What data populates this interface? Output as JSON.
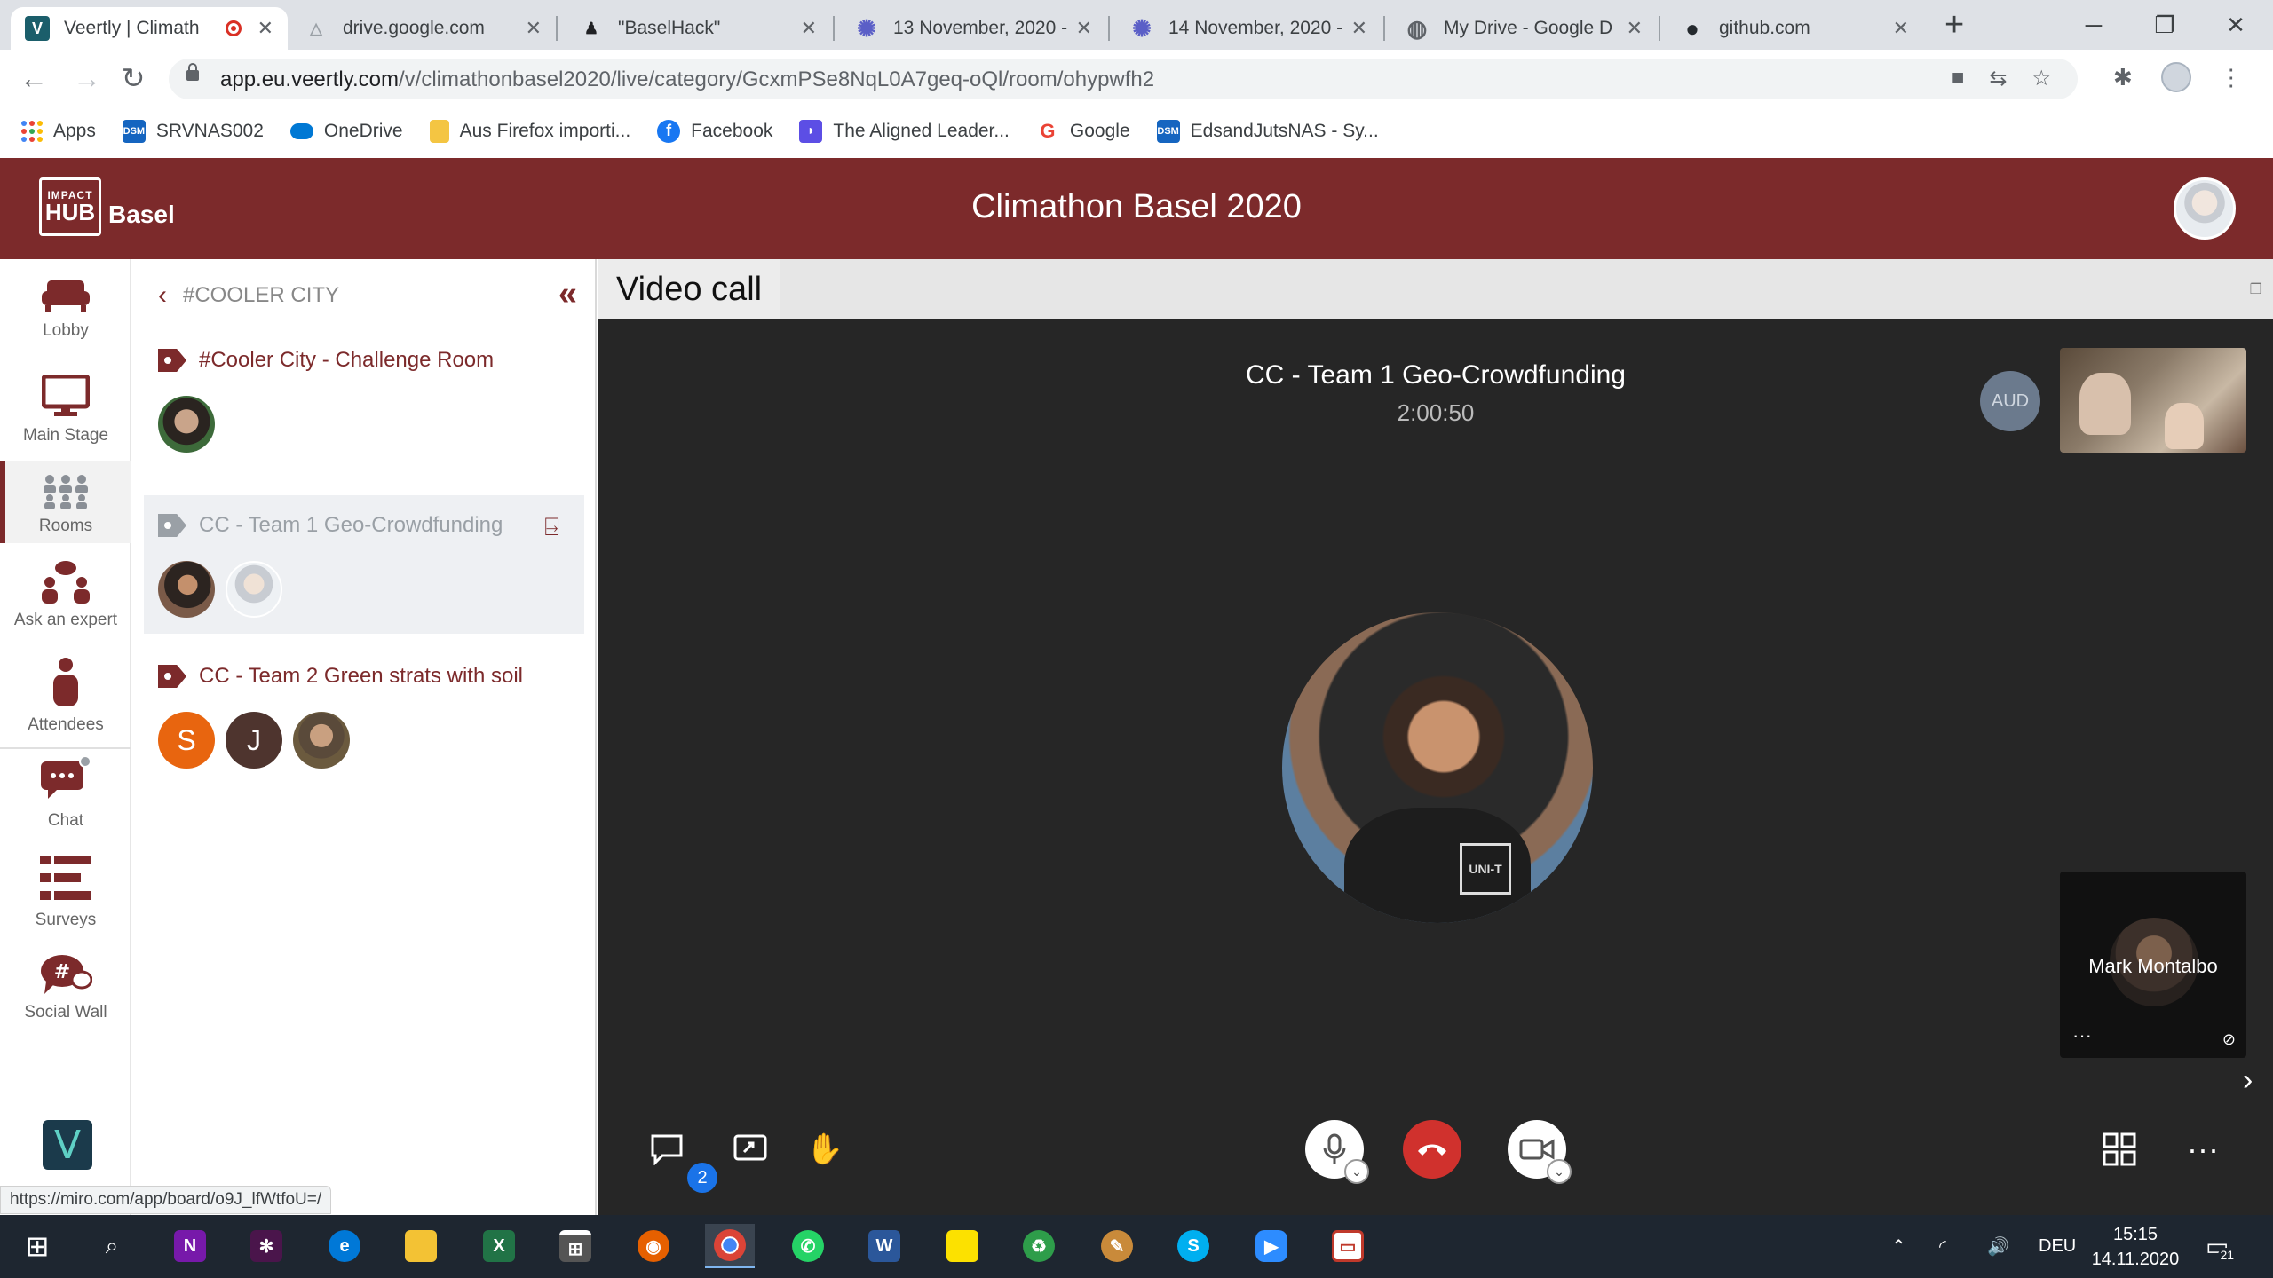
{
  "browser": {
    "tabs": [
      {
        "title": "Veertly | Climath",
        "favicon_color": "#1b5e6b",
        "glyph": "V"
      },
      {
        "title": "drive.google.com",
        "favicon_color": "#9aa0a6",
        "glyph": "△"
      },
      {
        "title": "\"BaselHack\"",
        "favicon_color": "#202124",
        "glyph": "♟"
      },
      {
        "title": "13 November, 2020 -",
        "favicon_color": "#5b5fc7",
        "glyph": "✺"
      },
      {
        "title": "14 November, 2020 -",
        "favicon_color": "#5b5fc7",
        "glyph": "✺"
      },
      {
        "title": "My Drive - Google D",
        "favicon_color": "#5f6368",
        "glyph": "◍"
      },
      {
        "title": "github.com",
        "favicon_color": "#24292e",
        "glyph": "●"
      }
    ],
    "new_tab_glyph": "+",
    "url_host": "app.eu.veertly.com",
    "url_path": "/v/climathonbasel2020/live/category/GcxmPSe8NqL0A7geq-oQl/room/ohypwfh2",
    "bookmarks": [
      {
        "label": "Apps",
        "icon": "apps-icon"
      },
      {
        "label": "SRVNAS002",
        "icon": "dsm-icon",
        "color": "#1565c0"
      },
      {
        "label": "OneDrive",
        "icon": "cloud-icon",
        "color": "#0078d4"
      },
      {
        "label": "Aus Firefox importi...",
        "icon": "folder-icon",
        "color": "#f4c542"
      },
      {
        "label": "Facebook",
        "icon": "facebook-icon",
        "color": "#1877f2"
      },
      {
        "label": "The Aligned Leader...",
        "icon": "aligned-icon",
        "color": "#5c4ee5"
      },
      {
        "label": "Google",
        "icon": "google-icon",
        "color": "#ea4335"
      },
      {
        "label": "EdsandJutsNAS - Sy...",
        "icon": "dsm-icon",
        "color": "#1565c0"
      }
    ],
    "status_url": "https://miro.com/app/board/o9J_lfWtfoU=/"
  },
  "header": {
    "logo_small": "IMPACT",
    "logo_big": "HUB",
    "logo_city": "Basel",
    "event_title": "Climathon Basel 2020",
    "brand_color": "#7c2a2b"
  },
  "nav": {
    "items": [
      {
        "label": "Lobby",
        "icon": "sofa-icon"
      },
      {
        "label": "Main Stage",
        "icon": "monitor-icon"
      },
      {
        "label": "Rooms",
        "icon": "group-icon",
        "active": true
      },
      {
        "label": "Ask an expert",
        "icon": "experts-icon"
      },
      {
        "label": "Attendees",
        "icon": "person-icon"
      },
      {
        "label": "Chat",
        "icon": "chat-icon"
      },
      {
        "label": "Surveys",
        "icon": "surveys-icon"
      },
      {
        "label": "Social Wall",
        "icon": "hashtag-icon"
      }
    ],
    "footer_logo": "V"
  },
  "rooms_panel": {
    "category": "#COOLER CITY",
    "rooms": [
      {
        "title": "#Cooler City - Challenge Room",
        "avatars": [
          {
            "type": "photo",
            "color": "#3a3128"
          }
        ]
      },
      {
        "title": "CC - Team 1 Geo-Crowdfunding",
        "active": true,
        "avatars": [
          {
            "type": "photo",
            "color": "#4a3a30"
          },
          {
            "type": "photo",
            "color": "#d8dde3"
          }
        ]
      },
      {
        "title": "CC - Team 2 Green strats with soil",
        "avatars": [
          {
            "type": "letter",
            "letter": "S",
            "color": "#e8650f"
          },
          {
            "type": "letter",
            "letter": "J",
            "color": "#4e342e"
          },
          {
            "type": "photo",
            "color": "#6b5a3e"
          }
        ]
      }
    ]
  },
  "video": {
    "tab_label": "Video call",
    "room_title": "CC - Team 1 Geo-Crowdfunding",
    "timer": "2:00:50",
    "audio_only_label": "AUD",
    "participant_name": "Mark Montalbo",
    "chat_badge": "2",
    "more_glyph": "···"
  },
  "taskbar": {
    "language": "DEU",
    "time": "15:15",
    "date": "14.11.2020",
    "notifications": "21"
  }
}
